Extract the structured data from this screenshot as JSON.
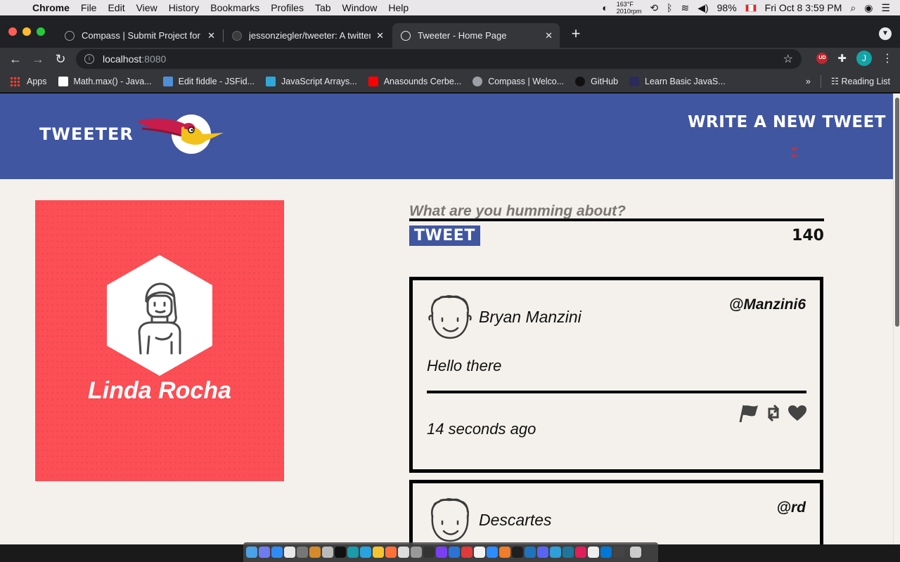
{
  "menubar": {
    "app_name": "Chrome",
    "items": [
      "File",
      "Edit",
      "View",
      "History",
      "Bookmarks",
      "Profiles",
      "Tab",
      "Window",
      "Help"
    ],
    "temperature": "163°F",
    "fan": "2010rpm",
    "battery": "98%",
    "datetime": "Fri Oct 8  3:59 PM"
  },
  "tabs": [
    {
      "title": "Compass | Submit Project for E"
    },
    {
      "title": "jessonziegler/tweeter: A twitter"
    },
    {
      "title": "Tweeter - Home Page"
    }
  ],
  "omnibox": {
    "host": "localhost",
    "port": ":8080"
  },
  "profile_initial": "J",
  "bookmarks": {
    "apps": "Apps",
    "items": [
      {
        "label": "Math.max() - Java...",
        "color": "#ffffff"
      },
      {
        "label": "Edit fiddle - JSFid...",
        "color": "#4f8fd8"
      },
      {
        "label": "JavaScript Arrays...",
        "color": "#2fa7d8"
      },
      {
        "label": "Anasounds Cerbe...",
        "color": "#ff0000"
      },
      {
        "label": "Compass | Welco...",
        "color": "#9aa0a6"
      },
      {
        "label": "GitHub",
        "color": "#111111"
      },
      {
        "label": "Learn Basic JavaS...",
        "color": "#2b2b5a"
      }
    ],
    "overflow": "»",
    "reading_list": "Reading List"
  },
  "site": {
    "brand": "Tweeter",
    "write_new": "Write a new tweet",
    "nav_color": "#4056a1",
    "accent": "#d32f2f"
  },
  "profile": {
    "name": "Linda Rocha",
    "card_color": "#fc4e55"
  },
  "compose": {
    "placeholder": "What are you humming about?",
    "button": "Tweet",
    "counter": "140"
  },
  "tweets": [
    {
      "author": "Bryan Manzini",
      "handle": "@Manzini6",
      "content": "Hello there",
      "time": "14 seconds ago"
    },
    {
      "author": "Descartes",
      "handle": "@rd",
      "content": "",
      "time": ""
    }
  ],
  "icons": {
    "flag": "flag-icon",
    "retweet": "retweet-icon",
    "like": "heart-icon"
  }
}
